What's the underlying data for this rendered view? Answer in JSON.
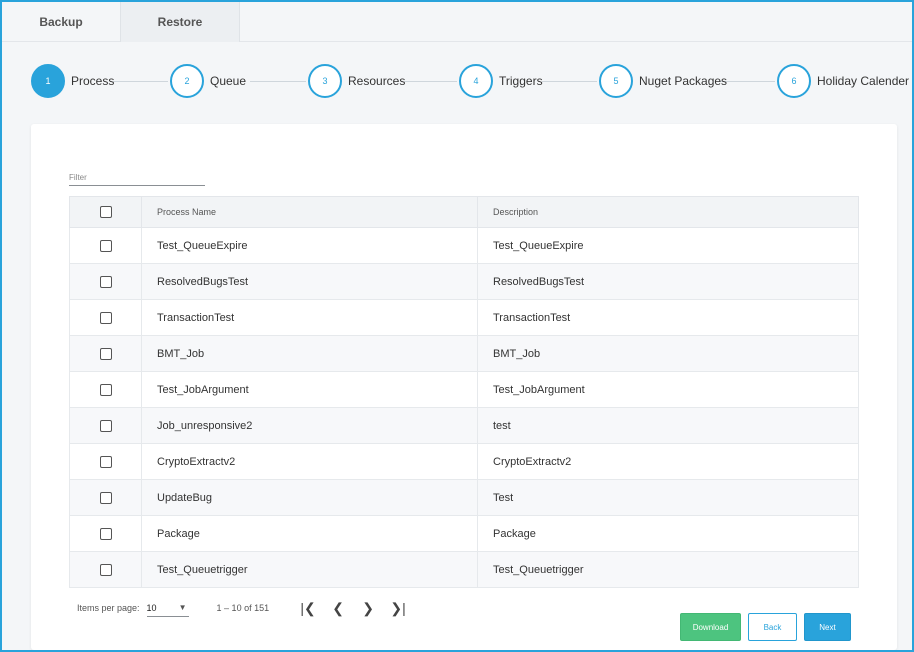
{
  "tabs": [
    {
      "label": "Backup"
    },
    {
      "label": "Restore"
    }
  ],
  "steps": [
    {
      "num": "1",
      "label": "Process"
    },
    {
      "num": "2",
      "label": "Queue"
    },
    {
      "num": "3",
      "label": "Resources"
    },
    {
      "num": "4",
      "label": "Triggers"
    },
    {
      "num": "5",
      "label": "Nuget Packages"
    },
    {
      "num": "6",
      "label": "Holiday Calender"
    }
  ],
  "filter": {
    "placeholder": "Filter",
    "value": ""
  },
  "table": {
    "headers": [
      "Process Name",
      "Description"
    ],
    "rows": [
      {
        "name": "Test_QueueExpire",
        "desc": "Test_QueueExpire"
      },
      {
        "name": "ResolvedBugsTest",
        "desc": "ResolvedBugsTest"
      },
      {
        "name": "TransactionTest",
        "desc": "TransactionTest"
      },
      {
        "name": "BMT_Job",
        "desc": "BMT_Job"
      },
      {
        "name": "Test_JobArgument",
        "desc": "Test_JobArgument"
      },
      {
        "name": "Job_unresponsive2",
        "desc": "test"
      },
      {
        "name": "CryptoExtractv2",
        "desc": "CryptoExtractv2"
      },
      {
        "name": "UpdateBug",
        "desc": "Test"
      },
      {
        "name": "Package",
        "desc": "Package"
      },
      {
        "name": "Test_Queuetrigger",
        "desc": "Test_Queuetrigger"
      }
    ]
  },
  "pagination": {
    "items_per_page_label": "Items per page:",
    "items_per_page": "10",
    "range": "1 – 10 of 151",
    "first_glyph": "|❮",
    "prev_glyph": "❮",
    "next_glyph": "❯",
    "last_glyph": "❯|"
  },
  "buttons": {
    "download": "Download",
    "back": "Back",
    "next": "Next"
  },
  "colors": {
    "accent": "#29a3db",
    "download": "#4dc47f"
  }
}
